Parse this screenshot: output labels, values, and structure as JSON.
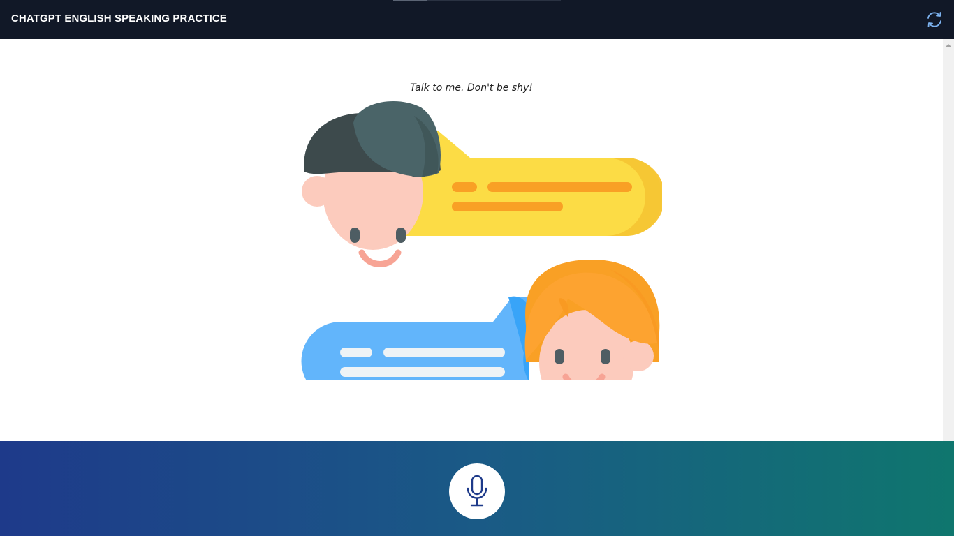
{
  "header": {
    "title": "CHATGPT ENGLISH SPEAKING PRACTICE",
    "refresh_icon": "refresh-icon"
  },
  "main": {
    "tagline": "Talk to me. Don't be shy!",
    "illustration_icon": "two-people-chatting-illustration"
  },
  "footer": {
    "mic_icon": "microphone-icon"
  },
  "colors": {
    "header_bg": "#111827",
    "footer_gradient_start": "#1e3a8a",
    "footer_gradient_end": "#0f766e",
    "mic_icon_color": "#1e3a8a"
  }
}
